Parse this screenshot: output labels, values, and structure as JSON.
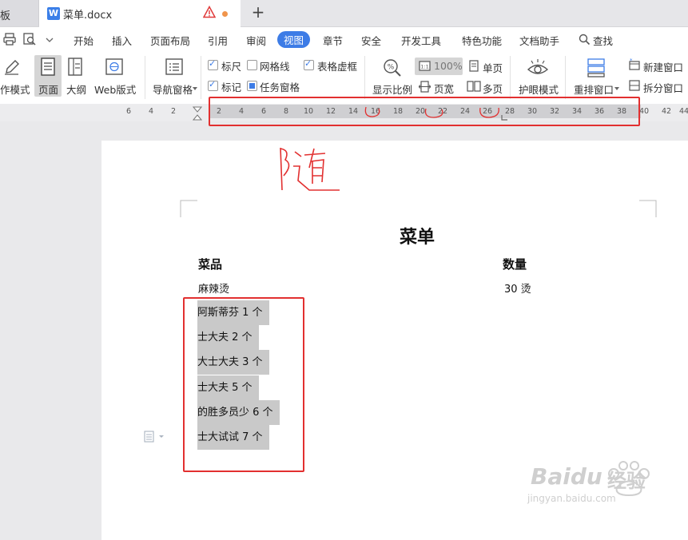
{
  "tabs": {
    "prev_label": "板",
    "active_title": "菜单.docx",
    "doc_icon_letter": "W",
    "new_tab_glyph": "+"
  },
  "menu": {
    "items": [
      "开始",
      "插入",
      "页面布局",
      "引用",
      "审阅",
      "视图",
      "章节",
      "安全",
      "开发工具",
      "特色功能",
      "文档助手"
    ],
    "active": "视图",
    "search_label": "查找"
  },
  "ribbon": {
    "edit_mode_label": "作模式",
    "page_label": "页面",
    "outline_label": "大纲",
    "web_label": "Web版式",
    "nav_pane_label": "导航窗格",
    "ruler_label": "标尺",
    "ruler_checked": true,
    "gridlines_label": "网格线",
    "gridlines_checked": false,
    "table_gridlines_label": "表格虚框",
    "table_gridlines_checked": true,
    "marks_label": "标记",
    "marks_checked": true,
    "task_pane_label": "任务窗格",
    "task_pane_checked": true,
    "zoom_label": "显示比例",
    "zoom_value": "100%",
    "page_width_label": "页宽",
    "single_page_label": "单页",
    "multi_page_label": "多页",
    "eye_mode_label": "护眼模式",
    "rearrange_label": "重排窗口",
    "new_window_label": "新建窗口",
    "split_window_label": "拆分窗口"
  },
  "ruler": {
    "left_numbers": [
      "6",
      "4",
      "2"
    ],
    "numbers": [
      "2",
      "4",
      "6",
      "8",
      "10",
      "12",
      "14",
      "16",
      "18",
      "20",
      "22",
      "24",
      "26",
      "28",
      "30",
      "32",
      "34",
      "36",
      "38",
      "40",
      "42",
      "44"
    ]
  },
  "document": {
    "handwriting": "随",
    "title": "菜单",
    "header_dish": "菜品",
    "header_qty": "数量",
    "first_row_dish": "麻辣烫",
    "first_row_qty": "30 烫",
    "selected_lines": [
      "阿斯蒂芬 1 个",
      "士大夫 2 个",
      "大士大夫 3 个",
      "士大夫 5 个",
      "的胜多员少 6 个",
      "士大试试 7 个"
    ]
  },
  "watermark": {
    "brand": "Baidu",
    "brand_cn": "经验",
    "url": "jingyan.baidu.com"
  },
  "colors": {
    "accent": "#3d7ce6",
    "annotation_red": "#e23030",
    "highlight_gray": "#c9c9c9"
  }
}
